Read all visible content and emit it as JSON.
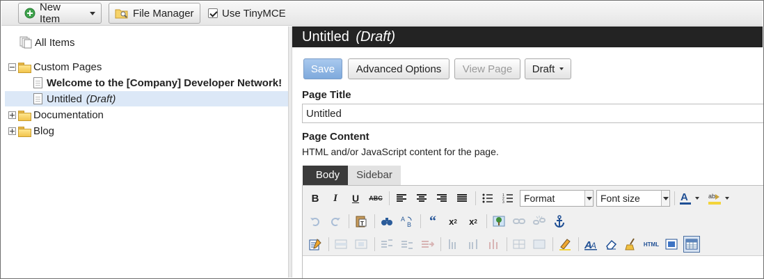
{
  "toolbar": {
    "new_item_label": "New Item",
    "file_manager_label": "File Manager",
    "use_tinymce_label": "Use TinyMCE",
    "use_tinymce_checked": true
  },
  "tree": {
    "all_items": "All Items",
    "custom_pages": "Custom Pages",
    "welcome_page": "Welcome to the [Company] Developer Network!",
    "untitled_page": "Untitled",
    "untitled_draft": "(Draft)",
    "documentation": "Documentation",
    "blog": "Blog"
  },
  "editor": {
    "title": "Untitled",
    "title_status": "(Draft)",
    "save_label": "Save",
    "advanced_options_label": "Advanced Options",
    "view_page_label": "View Page",
    "status_dropdown_label": "Draft",
    "page_title_label": "Page Title",
    "page_title_value": "Untitled",
    "page_content_label": "Page Content",
    "page_content_help": "HTML and/or JavaScript content for the page.",
    "tabs": [
      "Body",
      "Sidebar"
    ],
    "format_select": "Format",
    "font_size_select": "Font size"
  },
  "colors": {
    "title_bar": "#232323",
    "selection": "#dce8f7",
    "primary_button": "#8cb4e2"
  }
}
